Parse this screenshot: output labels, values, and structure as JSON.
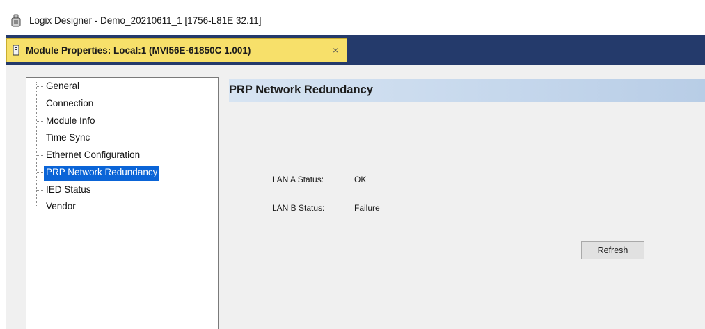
{
  "window": {
    "title": "Logix Designer - Demo_20210611_1 [1756-L81E 32.11]",
    "icon": "logix-app-icon"
  },
  "tab": {
    "label": "Module Properties: Local:1 (MVI56E-61850C 1.001)",
    "close": "×",
    "icon": "module-icon",
    "color": "#f7e06a"
  },
  "tabstrip_color": "#243a6b",
  "sidebar": {
    "items": [
      {
        "label": "General"
      },
      {
        "label": "Connection"
      },
      {
        "label": "Module Info"
      },
      {
        "label": "Time Sync"
      },
      {
        "label": "Ethernet Configuration"
      },
      {
        "label": "PRP Network Redundancy",
        "selected": true
      },
      {
        "label": "IED Status"
      },
      {
        "label": "Vendor"
      }
    ],
    "selected_color": "#0a64d7"
  },
  "main": {
    "title": "PRP Network Redundancy",
    "lan_a": {
      "label": "LAN A Status:",
      "value": "OK"
    },
    "lan_b": {
      "label": "LAN B Status:",
      "value": "Failure"
    },
    "refresh_label": "Refresh"
  }
}
